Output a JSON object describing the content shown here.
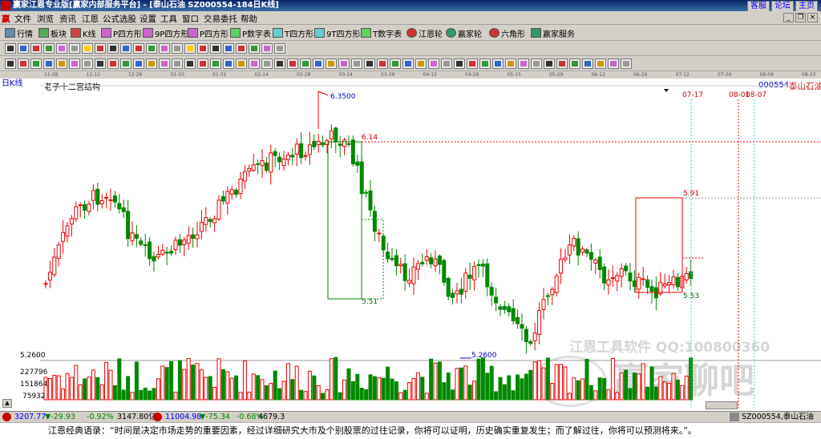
{
  "window": {
    "title": "赢家江恩专业版[赢家内部服务平台] - [泰山石油  SZ000554-184日K线]",
    "links": [
      "客服",
      "论坛",
      "主页"
    ]
  },
  "menu": [
    "文件",
    "浏览",
    "资讯",
    "江恩",
    "公式选股",
    "设置",
    "工具",
    "窗口",
    "交易委托",
    "帮助"
  ],
  "toolbar1": [
    "行情",
    "板块",
    "K线",
    "P四方形",
    "9P四方形",
    "P四方形",
    "P数字表",
    "T四方形",
    "9T四方形",
    "T数字表",
    "江恩轮",
    "赢家轮",
    "六角形",
    "赢家服务"
  ],
  "chart": {
    "period_label": "日K线",
    "indicator_title": "老子十二宫结构",
    "stock_code": "000554",
    "stock_name": "泰山石油",
    "dates": [
      "11-28",
      "12-12",
      "12-26",
      "01-10",
      "01-31",
      "02-14",
      "02-28",
      "03-14",
      "03-28",
      "04-12",
      "04-26",
      "05-15",
      "05-29",
      "06-12",
      "06-26",
      "07-12",
      "07-26",
      "08-09",
      "08-23"
    ],
    "marker_dates": [
      "07-17",
      "08-01",
      "08-07"
    ],
    "price_labels": {
      "high": "6.3500",
      "p614": "6.14",
      "p551": "5.51",
      "low": "5.2600",
      "p591": "5.91",
      "p553": "5.53",
      "axis_low": "5.2600"
    },
    "volume_ticks": [
      "227796",
      "151864",
      "75932"
    ],
    "watermark1": "江恩工具软件  QQ:100800360",
    "watermark2": "赢家聊吧"
  },
  "chart_data": {
    "type": "candlestick",
    "ylim": [
      5.26,
      6.35
    ],
    "high": 6.35,
    "low": 5.26
  },
  "statusbar": {
    "sh_index": "3207.77",
    "sh_change": "▼-29.93",
    "sh_pct": "-0.92%",
    "sh_amount": "3147.80亿",
    "sz_index": "11004.98",
    "sz_change": "▼-75.34",
    "sz_pct": "-0.68%",
    "sz_amount": "4679.3",
    "right": "SZ000554,泰山石油"
  },
  "quote": "江恩经典语录：“时间是决定市场走势的重要因素，经过详细研究大市及个别股票的过往记录，你将可以证明，历史确实重复发生；而了解过往，你将可以预测将来。”。"
}
